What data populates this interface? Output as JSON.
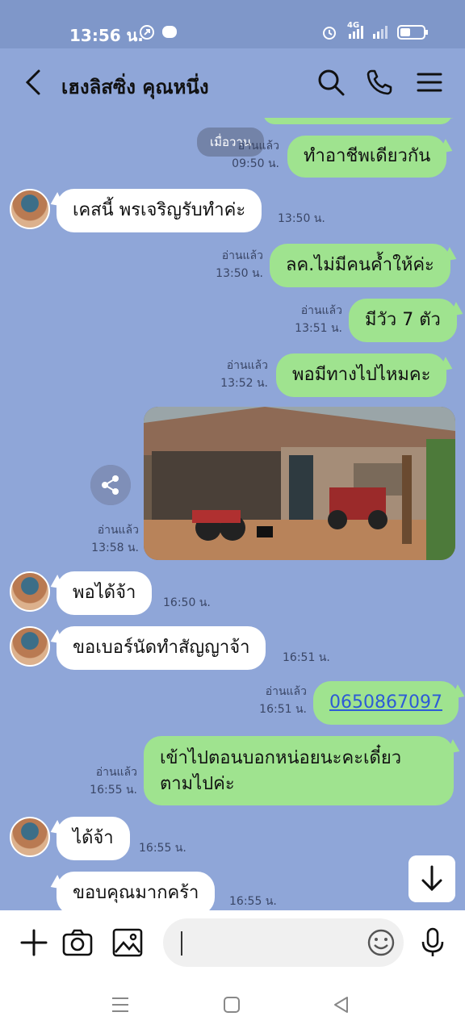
{
  "status_bar": {
    "time": "13:56 น.",
    "network": "4G"
  },
  "header": {
    "title": "เฮงลิสซิ่ง คุณหนึ่ง"
  },
  "date_chip": "เมื่อวาน",
  "messages": [
    {
      "dir": "out",
      "text": "ทำอาชีพเดียวกัน",
      "read": "อ่านแล้ว",
      "time": "09:50 น."
    },
    {
      "dir": "in",
      "text": "เคสนี้ พรเจริญรับทำค่ะ",
      "time": "13:50 น."
    },
    {
      "dir": "out",
      "text": "ลค.ไม่มีคนค้ำให้ค่ะ",
      "read": "อ่านแล้ว",
      "time": "13:50 น."
    },
    {
      "dir": "out",
      "text": "มีวัว 7 ตัว",
      "read": "อ่านแล้ว",
      "time": "13:51 น."
    },
    {
      "dir": "out",
      "text": "พอมีทางไปไหมคะ",
      "read": "อ่านแล้ว",
      "time": "13:52 น."
    },
    {
      "dir": "out-photo",
      "read": "อ่านแล้ว",
      "time": "13:58 น."
    },
    {
      "dir": "in",
      "text": "พอได้จ้า",
      "time": "16:50 น."
    },
    {
      "dir": "in",
      "text": "ขอเบอร์นัดทำสัญญาจ้า",
      "time": "16:51 น."
    },
    {
      "dir": "out",
      "text": "0650867097",
      "read": "อ่านแล้ว",
      "time": "16:51 น."
    },
    {
      "dir": "out",
      "text_line1": "เข้าไปตอนบอกหน่อยนะคะเดี๋ยว",
      "text_line2": "ตามไปค่ะ",
      "read": "อ่านแล้ว",
      "time": "16:55 น."
    },
    {
      "dir": "in",
      "text": "ได้จ้า",
      "time": "16:55 น."
    },
    {
      "dir": "in",
      "text": "ขอบคุณมากคร้า",
      "time": "16:55 น."
    }
  ],
  "input": {
    "placeholder": ""
  },
  "colors": {
    "chat_bg": "#8fa6d8",
    "outgoing_bubble": "#9fe38f",
    "incoming_bubble": "#ffffff",
    "link": "#2d5bd6"
  },
  "icons": [
    "back-arrow-icon",
    "search-icon",
    "phone-icon",
    "menu-icon",
    "share-icon",
    "plus-icon",
    "camera-icon",
    "image-icon",
    "emoji-icon",
    "mic-icon",
    "arrow-down-icon"
  ]
}
